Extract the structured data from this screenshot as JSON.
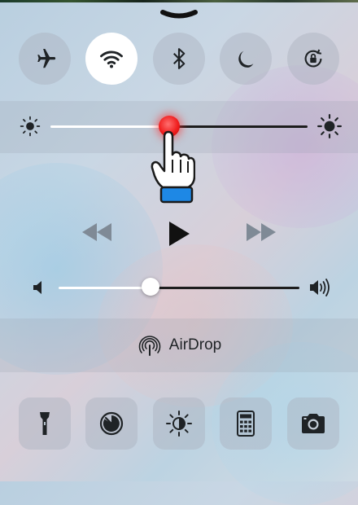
{
  "control_center": {
    "toggles": [
      {
        "icon": "airplane-icon",
        "state": "off"
      },
      {
        "icon": "wifi-icon",
        "state": "on"
      },
      {
        "icon": "bluetooth-icon",
        "state": "off"
      },
      {
        "icon": "moon-icon",
        "state": "off"
      },
      {
        "icon": "rotation-lock-icon",
        "state": "off"
      }
    ],
    "brightness": {
      "level": 0.46
    },
    "media": {
      "icons": [
        "rewind-icon",
        "play-icon",
        "fast-forward-icon"
      ]
    },
    "volume": {
      "level": 0.38
    },
    "airdrop": {
      "label": "AirDrop"
    },
    "shortcuts": [
      "flashlight-icon",
      "timer-icon",
      "night-shift-icon",
      "calculator-icon",
      "camera-icon"
    ],
    "colors": {
      "accent_red": "#f02020",
      "icon_dark": "#1f2326",
      "toggle_on": "#ffffff"
    }
  }
}
